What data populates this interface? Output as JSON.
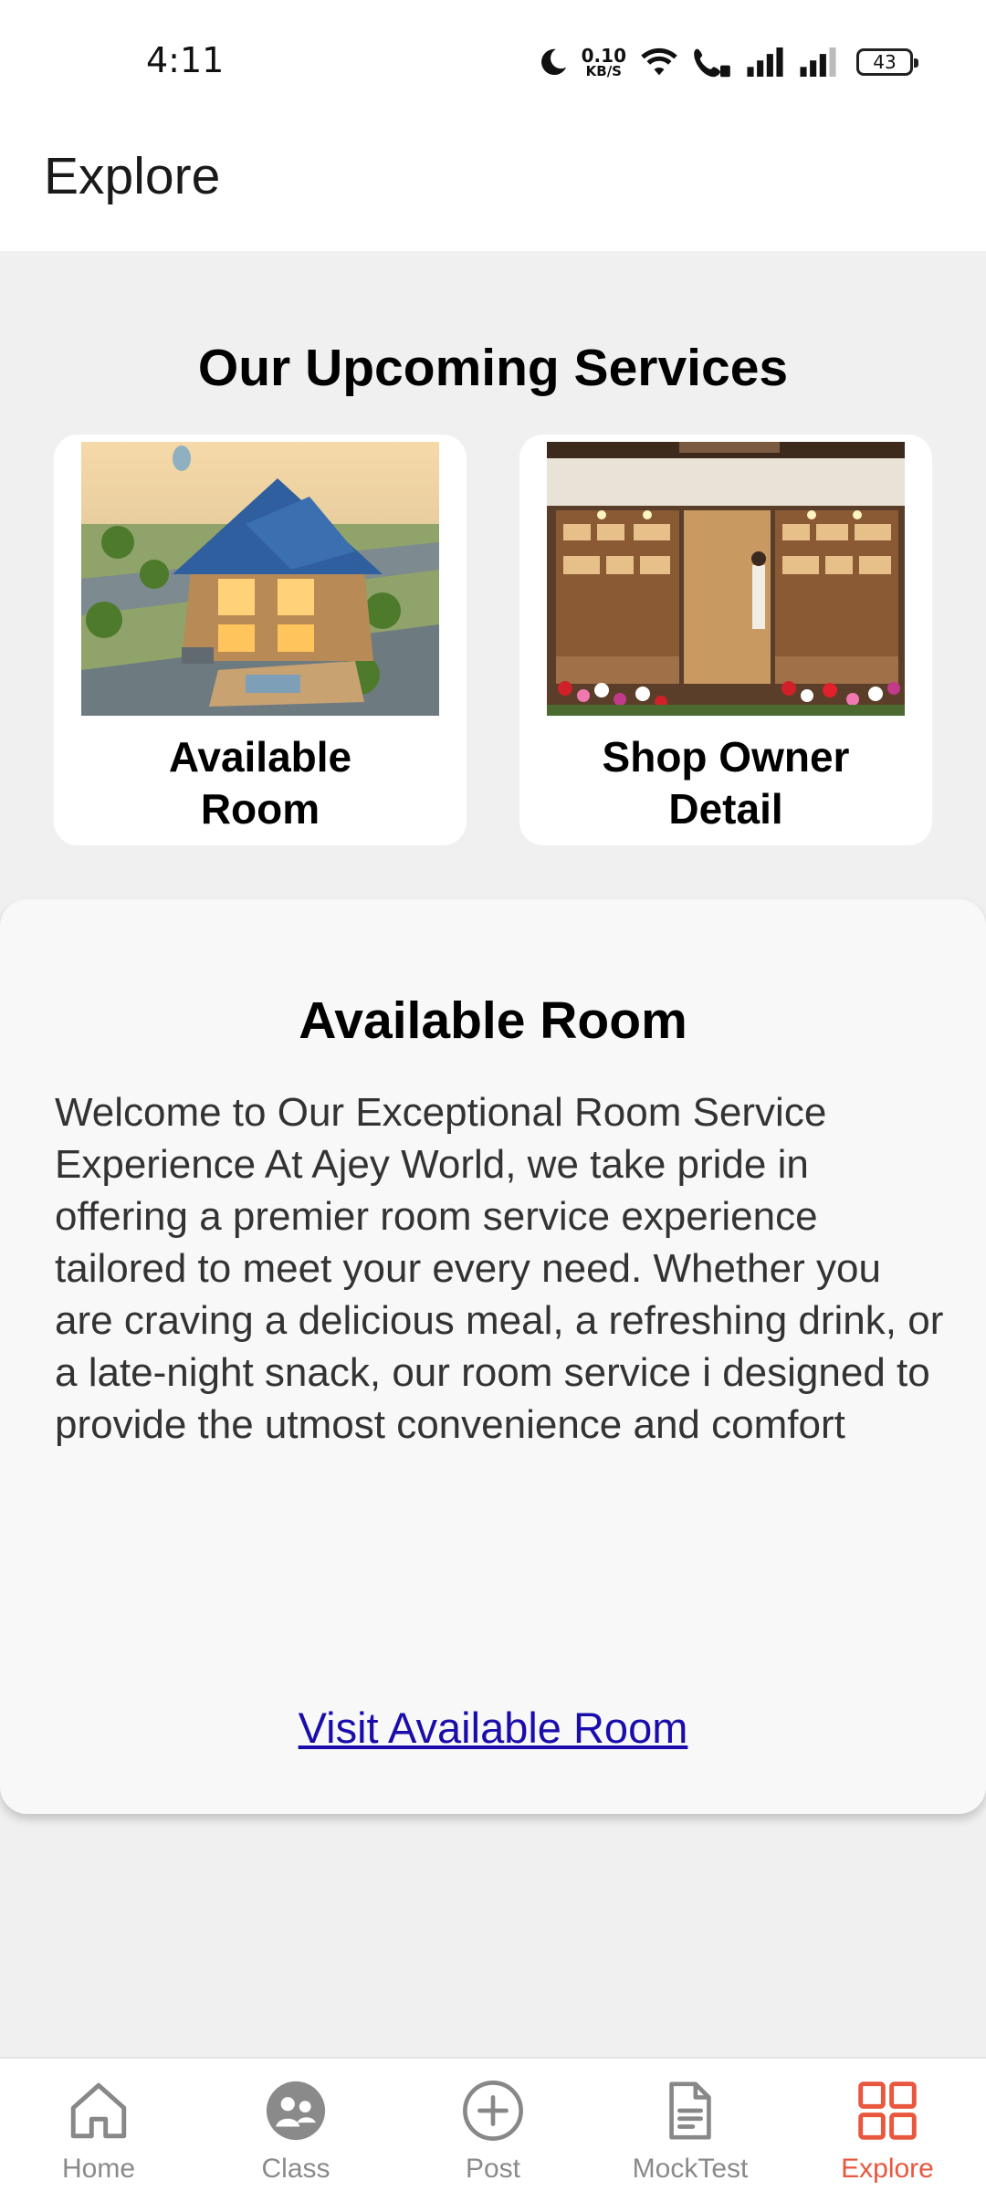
{
  "status_bar": {
    "time": "4:11",
    "net_speed_value": "0.10",
    "net_speed_unit": "KB/S",
    "battery": "43"
  },
  "header": {
    "title": "Explore"
  },
  "services": {
    "title": "Our Upcoming Services",
    "cards": [
      {
        "label_line1": "Available",
        "label_line2": "Room",
        "image": "house-illustration"
      },
      {
        "label_line1": "Shop Owner",
        "label_line2": "Detail",
        "image": "shop-storefront-illustration"
      }
    ]
  },
  "detail": {
    "title": "Available Room",
    "body": "Welcome to Our Exceptional Room Service Experience At Ajey World, we take pride in offering a premier room service experience tailored to meet your every need. Whether you are craving a delicious meal, a refreshing drink, or a late-night snack, our room service i designed to provide the utmost convenience and comfort",
    "link_label": "Visit Available Room"
  },
  "bottom_nav": {
    "items": [
      {
        "label": "Home",
        "icon": "home-icon"
      },
      {
        "label": "Class",
        "icon": "class-icon"
      },
      {
        "label": "Post",
        "icon": "plus-circle-icon"
      },
      {
        "label": "MockTest",
        "icon": "document-icon"
      },
      {
        "label": "Explore",
        "icon": "grid-icon"
      }
    ],
    "active": "Explore"
  },
  "colors": {
    "accent": "#e8573e",
    "link": "#1a0dab",
    "background": "#f0f0f0"
  }
}
